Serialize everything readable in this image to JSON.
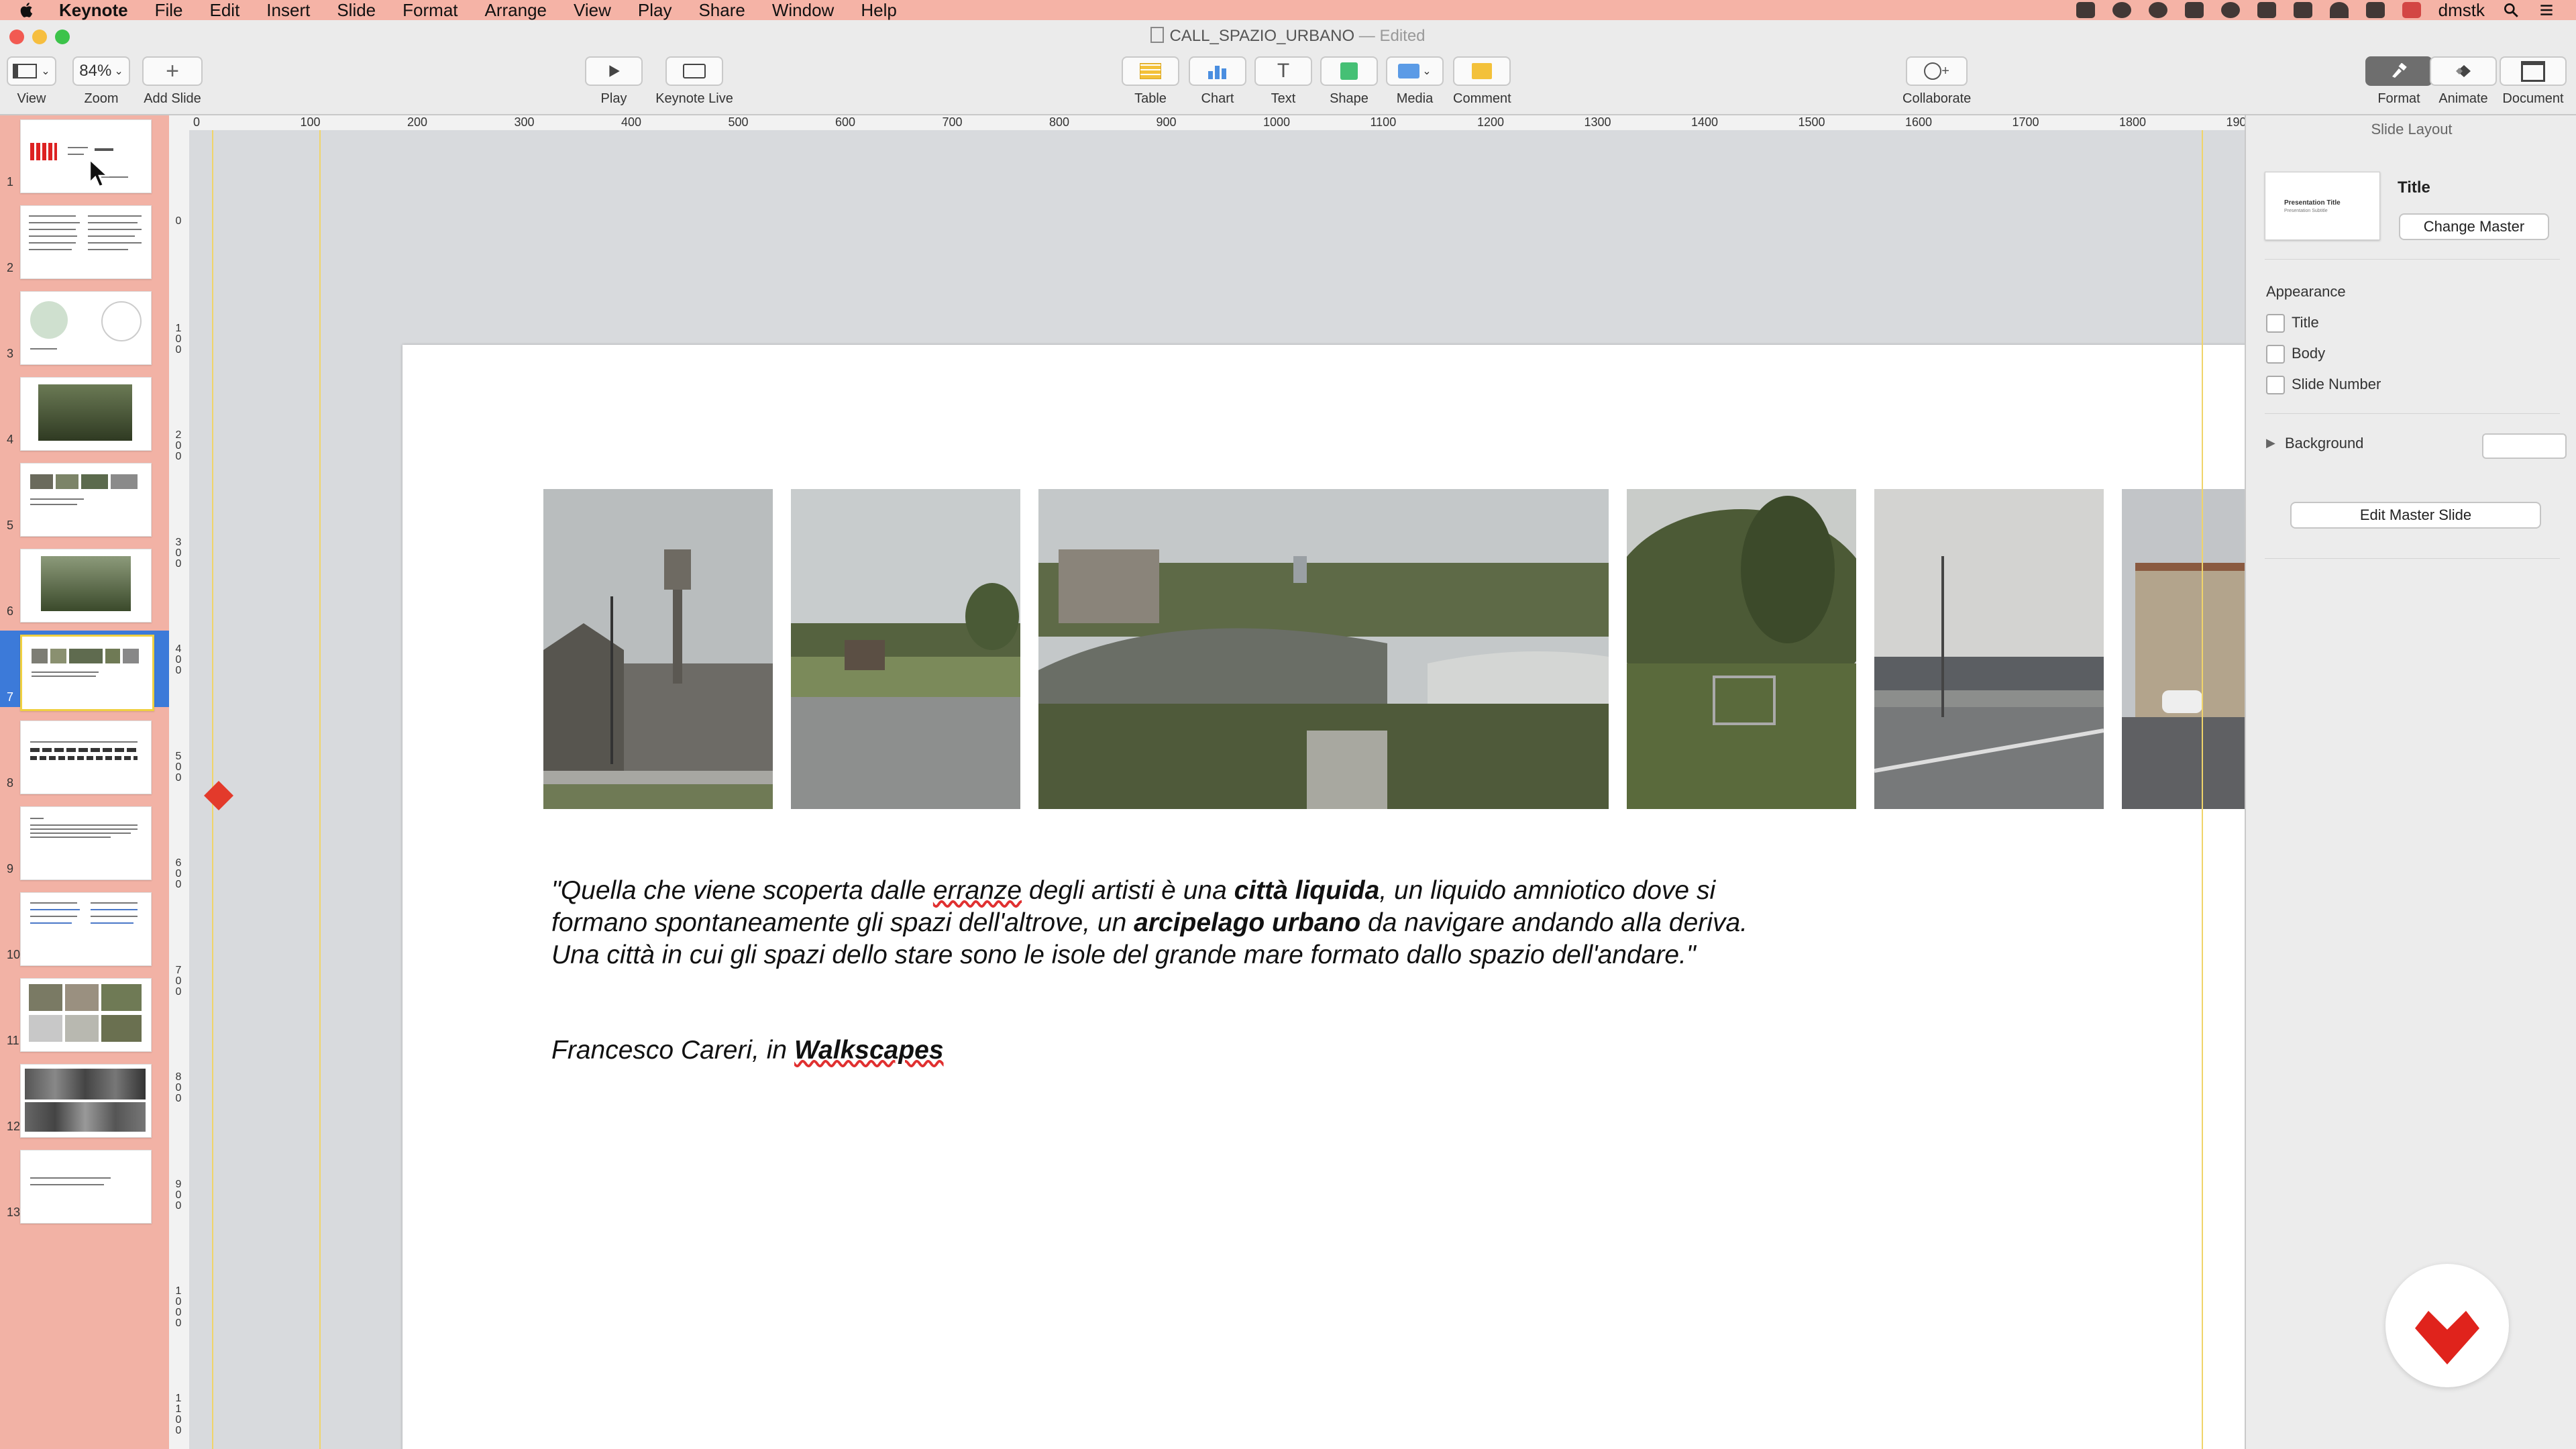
{
  "menubar": {
    "app": "Keynote",
    "items": [
      "File",
      "Edit",
      "Insert",
      "Slide",
      "Format",
      "Arrange",
      "View",
      "Play",
      "Share",
      "Window",
      "Help"
    ],
    "user": "dmstk"
  },
  "window": {
    "title": "CALL_SPAZIO_URBANO",
    "status": "— Edited"
  },
  "toolbar": {
    "view_label": "View",
    "zoom_value": "84%",
    "zoom_label": "Zoom",
    "add_slide_label": "Add Slide",
    "play_label": "Play",
    "keynote_live_label": "Keynote Live",
    "table_label": "Table",
    "chart_label": "Chart",
    "text_label": "Text",
    "shape_label": "Shape",
    "media_label": "Media",
    "comment_label": "Comment",
    "collaborate_label": "Collaborate",
    "format_label": "Format",
    "animate_label": "Animate",
    "document_label": "Document"
  },
  "navigator": {
    "slides": [
      "1",
      "2",
      "3",
      "4",
      "5",
      "6",
      "7",
      "8",
      "9",
      "10",
      "11",
      "12",
      "13"
    ],
    "selected_index": 6
  },
  "ruler": {
    "h_ticks": [
      "0",
      "100",
      "200",
      "300",
      "400",
      "500",
      "600",
      "700",
      "800",
      "900",
      "1000",
      "1100",
      "1200",
      "1300",
      "1400",
      "1500",
      "1600",
      "1700",
      "1800",
      "190"
    ],
    "v_ticks": [
      "0",
      "1\n0\n0",
      "2\n0\n0",
      "3\n0\n0",
      "4\n0\n0",
      "5\n0\n0",
      "6\n0\n0",
      "7\n0\n0",
      "8\n0\n0",
      "9\n0\n0",
      "1\n0\n0\n0",
      "1\n1\n0\n0"
    ]
  },
  "slide": {
    "quote_1": "\"Quella che viene scoperta dalle ",
    "quote_u1": "erranze",
    "quote_2": " degli artisti è una ",
    "quote_b1": "città liquida",
    "quote_3": ", un liquido amniotico dove si formano spontaneamente gli spazi dell'altrove, un ",
    "quote_b2": "arcipelago urbano",
    "quote_4": " da navigare andando alla deriva. Una città in cui gli spazi dello stare sono le isole del grande mare formato dallo spazio dell'andare.\"",
    "attrib_1": "Francesco Careri, in ",
    "attrib_b": "Walkscapes"
  },
  "inspector": {
    "header": "Slide Layout",
    "master_name": "Title",
    "master_thumb_title": "Presentation Title",
    "master_thumb_sub": "Presentation Subtitle",
    "change_master": "Change Master",
    "appearance": "Appearance",
    "opt_title": "Title",
    "opt_body": "Body",
    "opt_slide_number": "Slide Number",
    "background": "Background",
    "edit_master": "Edit Master Slide"
  },
  "colors": {
    "menubar": "#f5b3a6",
    "navigator": "#f2b2a5",
    "selection": "#3c7ad9",
    "guide": "#f0d46a",
    "brand_badge": "#e0231c"
  }
}
